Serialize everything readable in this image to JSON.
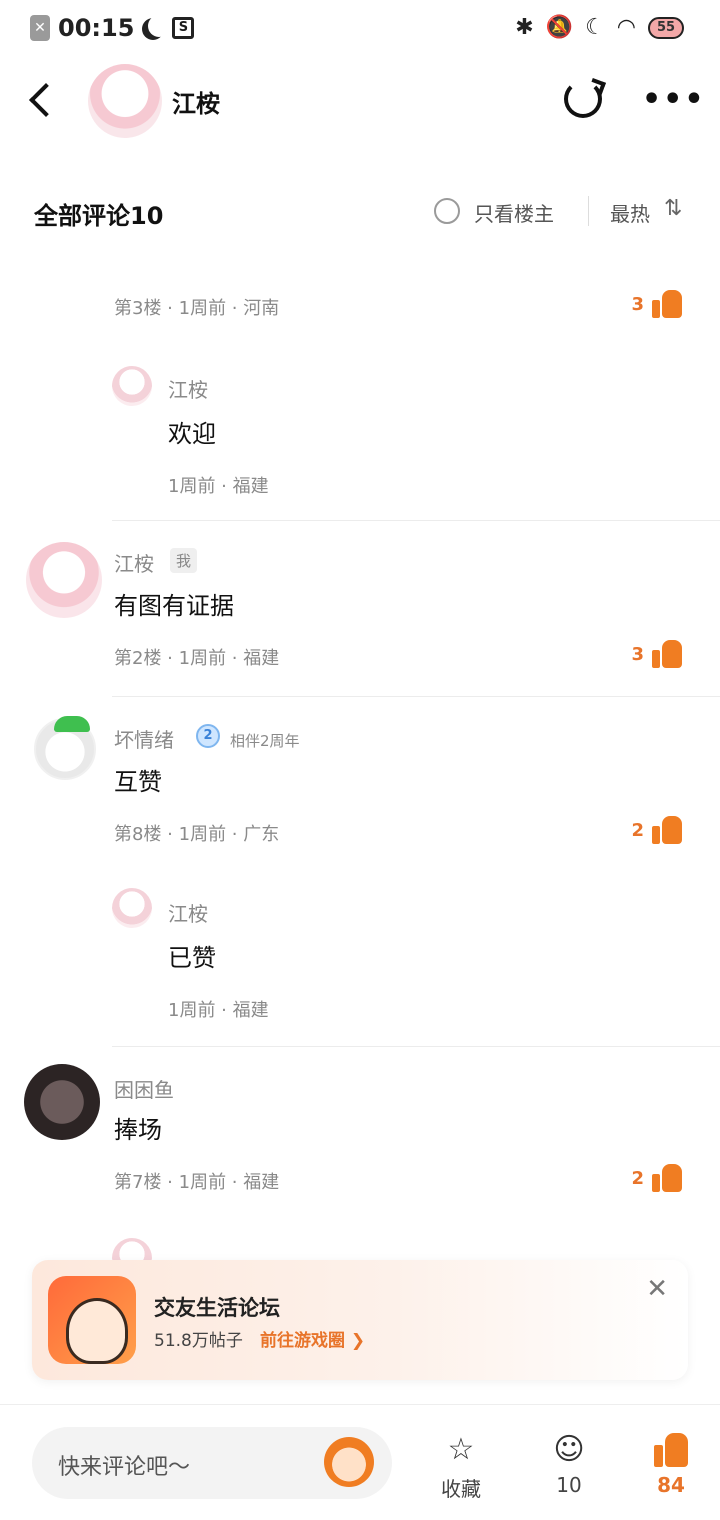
{
  "status_bar": {
    "time": "00:15",
    "battery": "55",
    "icons": [
      "close-square-icon",
      "moon-icon",
      "screenshot-icon",
      "bluetooth-icon",
      "bell-off-icon",
      "moon-icon",
      "wifi-icon",
      "battery-icon"
    ]
  },
  "header": {
    "username": "江桉",
    "icons": [
      "back-icon",
      "share-icon",
      "more-icon"
    ]
  },
  "comment_bar": {
    "title": "全部评论10",
    "only_op": "只看楼主",
    "sort": "最热",
    "sort_icon": "⇅"
  },
  "comments": [
    {
      "meta": "第3楼 · 1周前 · 河南",
      "likes": "3",
      "reply": {
        "name": "江桉",
        "text": "欢迎",
        "meta": "1周前 · 福建"
      }
    },
    {
      "name": "江桉",
      "badge": "我",
      "text": "有图有证据",
      "meta": "第2楼 · 1周前 · 福建",
      "likes": "3"
    },
    {
      "name": "坏情绪",
      "level": "2",
      "level_text": "相伴2周年",
      "text": "互赞",
      "meta": "第8楼 · 1周前 · 广东",
      "likes": "2",
      "reply": {
        "name": "江桉",
        "text": "已赞",
        "meta": "1周前 · 福建"
      }
    },
    {
      "name": "困困鱼",
      "text": "捧场",
      "meta": "第7楼 · 1周前 · 福建",
      "likes": "2"
    }
  ],
  "promo": {
    "title": "交友生活论坛",
    "posts": "51.8万帖子",
    "link": "前往游戏圈 ❯",
    "close": "✕"
  },
  "bottom_bar": {
    "input_placeholder": "快来评论吧～",
    "favorite_label": "收藏",
    "comment_count": "10",
    "like_count": "84"
  },
  "colors": {
    "accent": "#f07d22",
    "meta_text": "#8a8a8a"
  }
}
